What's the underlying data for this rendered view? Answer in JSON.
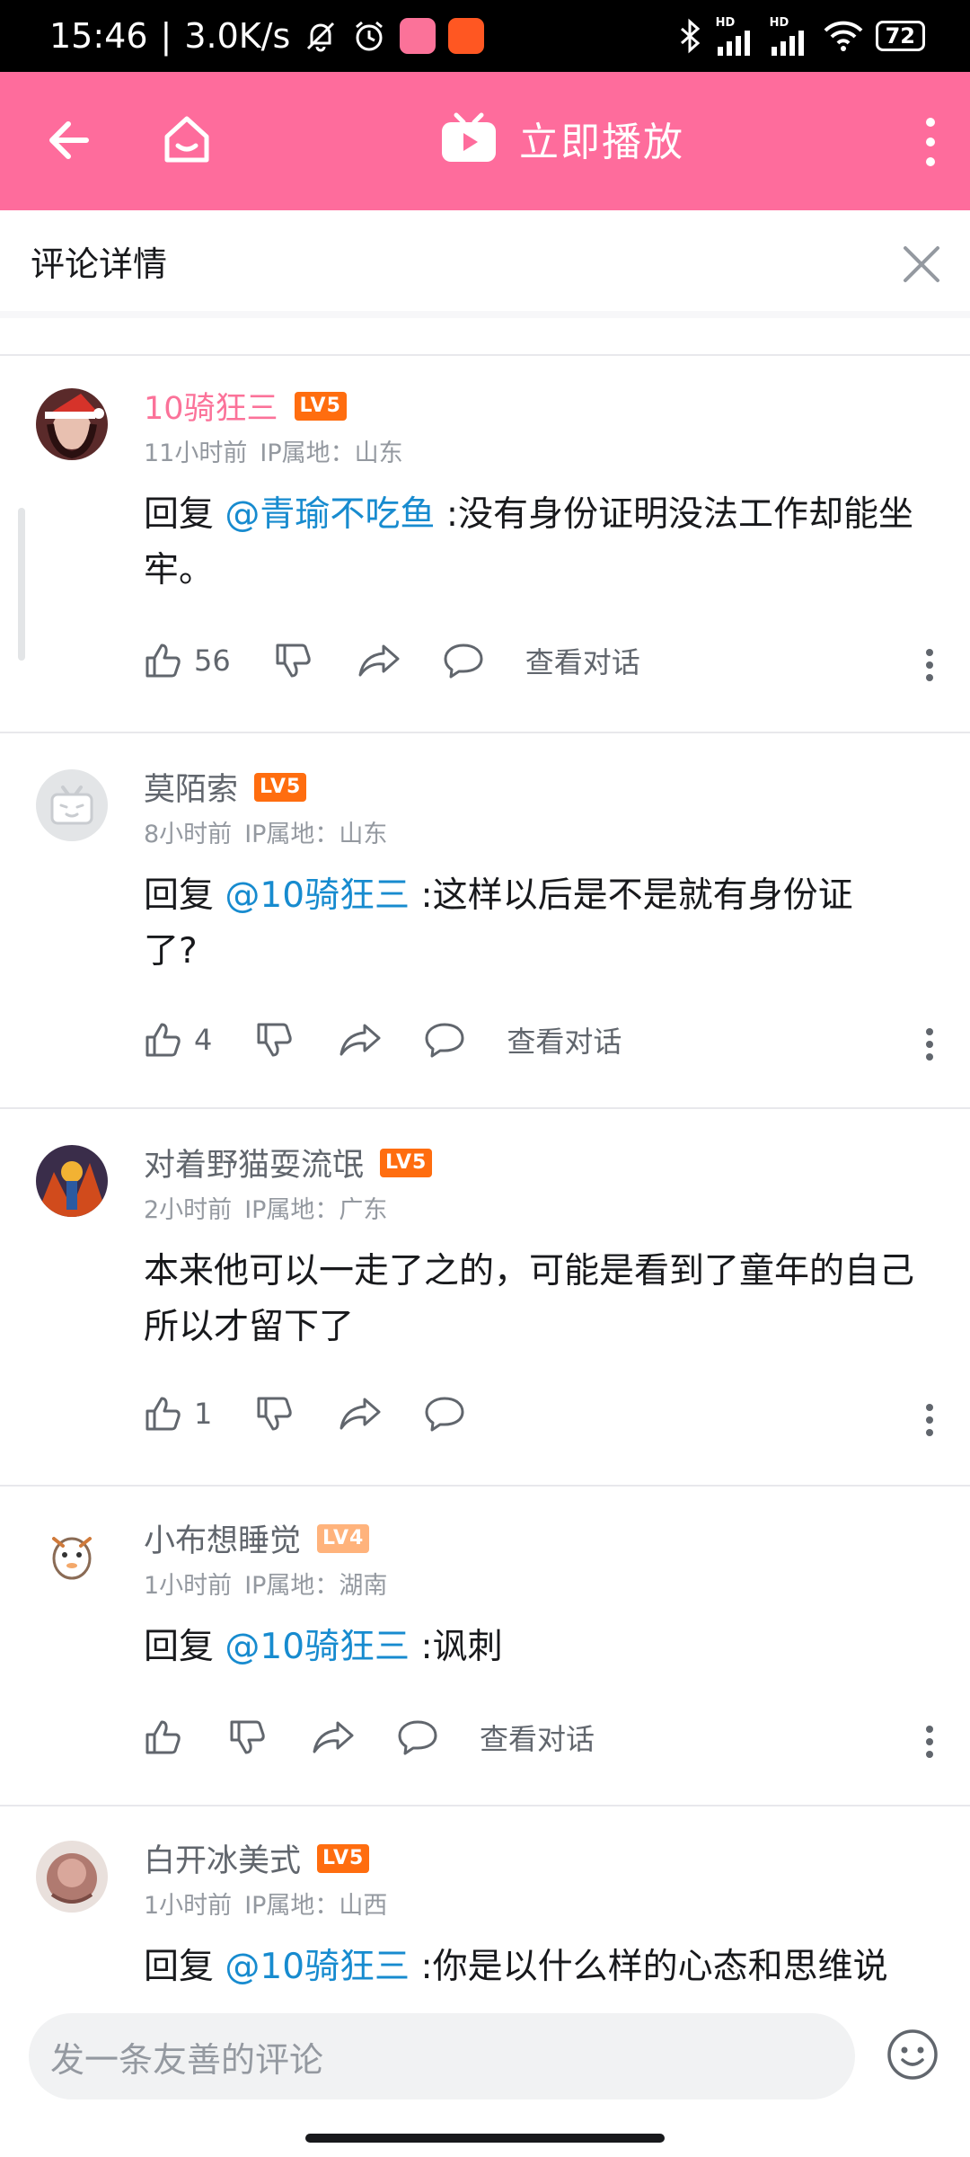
{
  "status_bar": {
    "time": "15:46",
    "speed": "3.0K/s",
    "battery": "72",
    "hd_label": "HD",
    "colors": {
      "app1": "#fb7299",
      "app2": "#ff5722"
    }
  },
  "app_bar": {
    "title": "立即播放",
    "background": "#fe6c9c"
  },
  "subhead": {
    "title": "评论详情"
  },
  "comments": [
    {
      "username": "10骑狂三",
      "level": "LV5",
      "time": "11小时前",
      "ip": "IP属地：山东",
      "reply_prefix": "回复 ",
      "mention": "@青瑜不吃鱼",
      "text": " :没有身份证明没法工作却能坐牢。",
      "likes": "56",
      "view_dialog": "查看对话"
    },
    {
      "username": "莫陌索",
      "level": "LV5",
      "time": "8小时前",
      "ip": "IP属地：山东",
      "reply_prefix": "回复 ",
      "mention": "@10骑狂三",
      "text": " :这样以后是不是就有身份证了?",
      "likes": "4",
      "view_dialog": "查看对话"
    },
    {
      "username": "对着野猫耍流氓",
      "level": "LV5",
      "time": "2小时前",
      "ip": "IP属地：广东",
      "text": "本来他可以一走了之的，可能是看到了童年的自己所以才留下了",
      "likes": "1"
    },
    {
      "username": "小布想睡觉",
      "level": "LV4",
      "time": "1小时前",
      "ip": "IP属地：湖南",
      "reply_prefix": "回复 ",
      "mention": "@10骑狂三",
      "text": " :讽刺",
      "view_dialog": "查看对话"
    },
    {
      "username": "白开冰美式",
      "level": "LV5",
      "time": "1小时前",
      "ip": "IP属地：山西",
      "reply_prefix": "回复 ",
      "mention": "@10骑狂三",
      "text": " :你是以什么样的心态和思维说"
    }
  ],
  "bottom": {
    "input_placeholder": "发一条友善的评论"
  },
  "colors": {
    "accent_pink": "#fb7299",
    "mention_blue": "#178bcf",
    "level_orange": "#ff6d0f",
    "level4": "#ffb37c"
  }
}
